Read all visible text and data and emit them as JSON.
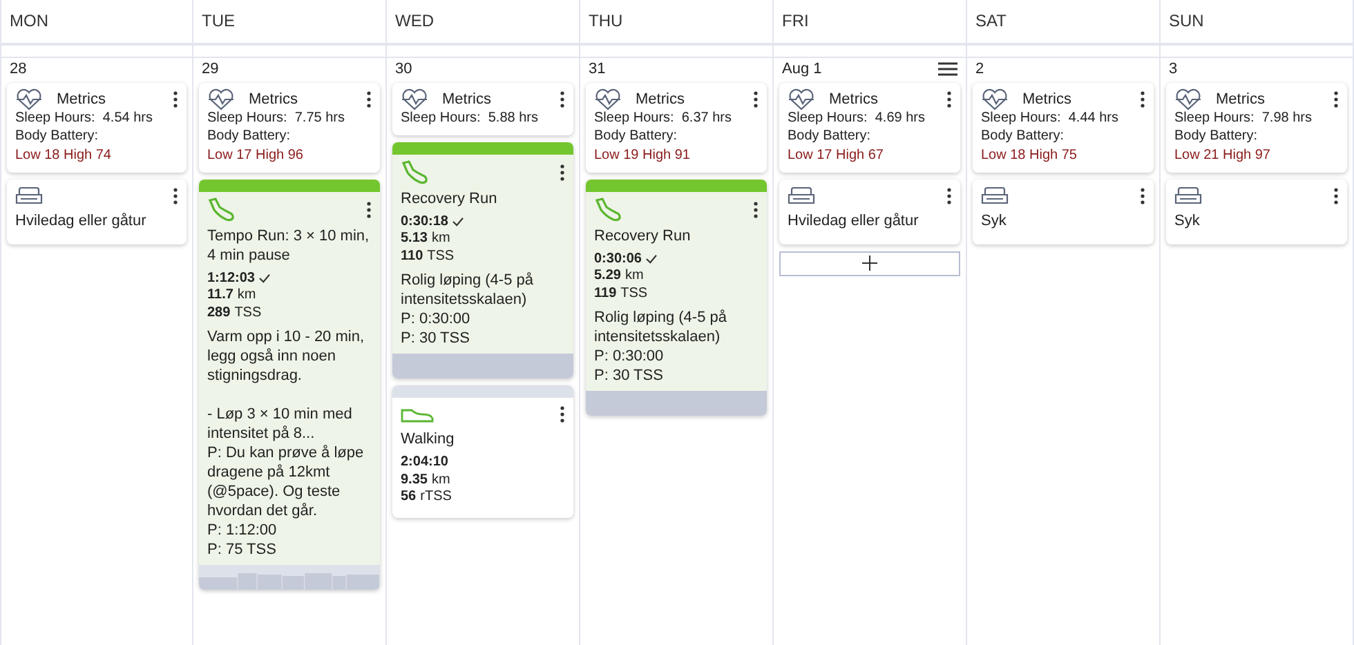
{
  "days": [
    {
      "name": "MON",
      "date": "28",
      "menu": false,
      "add_button": false,
      "items": [
        {
          "kind": "metrics",
          "title": "Metrics",
          "sleep_label": "Sleep Hours:",
          "sleep_value": "4.54 hrs",
          "battery_label": "Body Battery:",
          "battery_value": "Low 18 High 74"
        },
        {
          "kind": "rest",
          "title": "Hviledag eller gåtur"
        }
      ]
    },
    {
      "name": "TUE",
      "date": "29",
      "menu": false,
      "add_button": false,
      "items": [
        {
          "kind": "metrics",
          "title": "Metrics",
          "sleep_label": "Sleep Hours:",
          "sleep_value": "7.75 hrs",
          "battery_label": "Body Battery:",
          "battery_value": "Low 17 High 96"
        },
        {
          "kind": "run",
          "planned": true,
          "title": "Tempo Run: 3 × 10 min, 4 min pause",
          "duration": "1:12:03",
          "completed": true,
          "distance": "11.7",
          "distance_unit": "km",
          "load": "289",
          "load_unit": "TSS",
          "description": "Varm opp i 10 - 20 min, legg også inn noen stigningsdrag.\n\n- Løp 3 × 10 min med intensitet på 8...\nP: Du kan prøve å løpe dragene på 12kmt (@5pace). Og teste hvordan det går.",
          "planned_lines": [
            "P: 1:12:00",
            "P: 75 TSS"
          ],
          "profile": true
        }
      ]
    },
    {
      "name": "WED",
      "date": "30",
      "menu": false,
      "add_button": false,
      "items": [
        {
          "kind": "metrics",
          "title": "Metrics",
          "sleep_label": "Sleep Hours:",
          "sleep_value": "5.88 hrs"
        },
        {
          "kind": "run",
          "planned": true,
          "title": "Recovery Run",
          "duration": "0:30:18",
          "completed": true,
          "distance": "5.13",
          "distance_unit": "km",
          "load": "110",
          "load_unit": "TSS",
          "description": "Rolig løping (4-5 på intensitetsskalaen)",
          "planned_lines": [
            "P: 0:30:00",
            "P: 30 TSS"
          ],
          "profile": false
        },
        {
          "kind": "walk",
          "planned": false,
          "title": "Walking",
          "duration": "2:04:10",
          "completed": false,
          "distance": "9.35",
          "distance_unit": "km",
          "load": "56",
          "load_unit": "rTSS"
        }
      ]
    },
    {
      "name": "THU",
      "date": "31",
      "menu": false,
      "add_button": false,
      "items": [
        {
          "kind": "metrics",
          "title": "Metrics",
          "sleep_label": "Sleep Hours:",
          "sleep_value": "6.37 hrs",
          "battery_label": "Body Battery:",
          "battery_value": "Low 19 High 91"
        },
        {
          "kind": "run",
          "planned": true,
          "title": "Recovery Run",
          "duration": "0:30:06",
          "completed": true,
          "distance": "5.29",
          "distance_unit": "km",
          "load": "119",
          "load_unit": "TSS",
          "description": "Rolig løping (4-5 på intensitetsskalaen)",
          "planned_lines": [
            "P: 0:30:00",
            "P: 30 TSS"
          ],
          "profile": false
        }
      ]
    },
    {
      "name": "FRI",
      "date": "Aug 1",
      "menu": true,
      "add_button": true,
      "items": [
        {
          "kind": "metrics",
          "title": "Metrics",
          "sleep_label": "Sleep Hours:",
          "sleep_value": "4.69 hrs",
          "battery_label": "Body Battery:",
          "battery_value": "Low 17 High 67"
        },
        {
          "kind": "rest",
          "title": "Hviledag eller gåtur"
        }
      ]
    },
    {
      "name": "SAT",
      "date": "2",
      "menu": false,
      "add_button": false,
      "items": [
        {
          "kind": "metrics",
          "title": "Metrics",
          "sleep_label": "Sleep Hours:",
          "sleep_value": "4.44 hrs",
          "battery_label": "Body Battery:",
          "battery_value": "Low 18 High 75"
        },
        {
          "kind": "rest",
          "title": "Syk"
        }
      ]
    },
    {
      "name": "SUN",
      "date": "3",
      "menu": false,
      "add_button": false,
      "items": [
        {
          "kind": "metrics",
          "title": "Metrics",
          "sleep_label": "Sleep Hours:",
          "sleep_value": "7.98 hrs",
          "battery_label": "Body Battery:",
          "battery_value": "Low 21 High 97"
        },
        {
          "kind": "rest",
          "title": "Syk"
        }
      ]
    }
  ]
}
